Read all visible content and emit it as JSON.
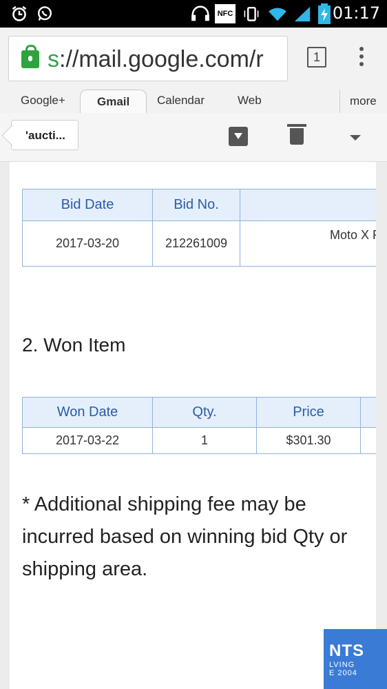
{
  "status_bar": {
    "time": "01:17",
    "icons": [
      "alarm-clock-icon",
      "whatsapp-icon",
      "headphones-icon",
      "nfc-icon",
      "vibrate-icon",
      "wifi-icon",
      "signal-icon",
      "battery-charging-icon"
    ],
    "nfc_label": "NFC"
  },
  "address_bar": {
    "url_scheme": "s",
    "url_rest": "://mail.google.com/r",
    "tab_count": "1"
  },
  "google_bar": {
    "tabs": [
      "Google+",
      "Gmail",
      "Calendar",
      "Web",
      "more"
    ],
    "active_tab": "Gmail"
  },
  "action_bar": {
    "back_label": "'aucti..."
  },
  "bids_table": {
    "headers": [
      "Bid Date",
      "Bid No.",
      ""
    ],
    "rows": [
      [
        "2017-03-20",
        "212261009",
        "Moto X For"
      ]
    ]
  },
  "won_section": {
    "title": "2. Won Item"
  },
  "won_table": {
    "headers": [
      "Won Date",
      "Qty.",
      "Price",
      ""
    ],
    "rows": [
      [
        "2017-03-22",
        "1",
        "$301.30",
        ""
      ]
    ]
  },
  "note": "* Additional shipping fee may be incurred based on winning bid Qty or shipping area.",
  "watermark": {
    "line1": "NTS",
    "line2": "LVING",
    "line3": "E 2004"
  },
  "colors": {
    "table_header_bg": "#e5effb",
    "table_header_text": "#2a5ca8",
    "table_border": "#8fb1e0",
    "secure_green": "#2ea43e"
  }
}
